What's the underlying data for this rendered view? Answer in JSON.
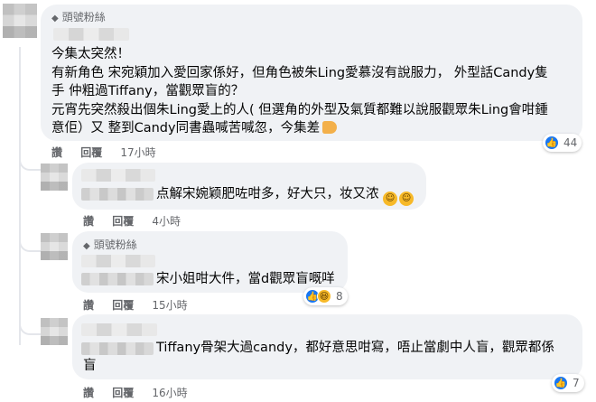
{
  "comments": [
    {
      "badge": "頭號粉絲",
      "lines": [
        "今集太突然！",
        "有新角色 宋宛穎加入愛回家係好，但角色被朱Ling愛慕沒有說服力， 外型話Candy隻",
        "手 仲粗過Tiffany，當觀眾盲的？",
        "元宵先突然殺出個朱Ling愛上的人( 但選角的外型及氣質都難以說服觀眾朱Ling會咁鍾",
        "意佢）又 整到Candy同書蟲喊苦喊忽，今集差"
      ],
      "actions": {
        "like": "讚",
        "reply": "回覆",
        "time": "17小時"
      },
      "reactions": {
        "count": "44",
        "like_icon": "thumbs-up-icon"
      }
    },
    {
      "badge": "",
      "lines": [
        "点解宋婉颖肥咗咁多，好大只，妆又浓"
      ],
      "actions": {
        "like": "讚",
        "reply": "回覆",
        "time": "4小時"
      },
      "reactions": null
    },
    {
      "badge": "頭號粉絲",
      "lines": [
        "宋小姐咁大件，當d觀眾盲嘅咩"
      ],
      "actions": {
        "like": "讚",
        "reply": "回覆",
        "time": "15小時"
      },
      "reactions": {
        "count": "8",
        "like_icon": "thumbs-up-icon",
        "haha_icon": "haha-icon"
      }
    },
    {
      "badge": "",
      "lines": [
        "Tiffany骨架大過candy，都好意思咁寫，唔止當劇中人盲，觀眾都係",
        "盲"
      ],
      "actions": {
        "like": "讚",
        "reply": "回覆",
        "time": "16小時"
      },
      "reactions": {
        "count": "7",
        "like_icon": "thumbs-up-icon"
      }
    }
  ],
  "colors": {
    "bubble": "#f0f2f5",
    "meta": "#65676b",
    "like": "#1877f2",
    "haha": "#f7b928"
  }
}
